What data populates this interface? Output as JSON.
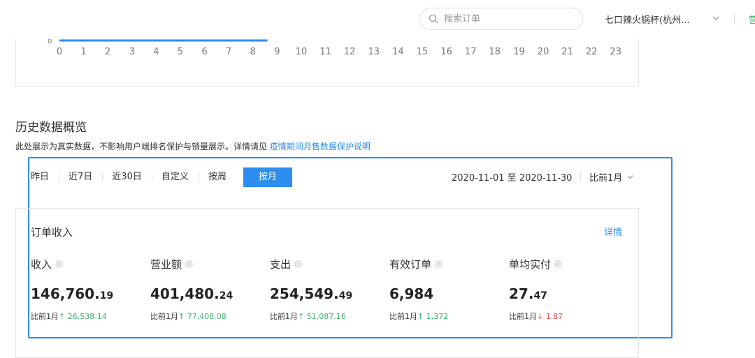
{
  "header": {
    "search_placeholder": "搜索订单",
    "store_name": "七口辣火锅杯(杭州...",
    "right_edge_text": "营"
  },
  "hourly_chart": {
    "x_ticks": [
      "0",
      "1",
      "2",
      "3",
      "4",
      "5",
      "6",
      "7",
      "8",
      "9",
      "10",
      "11",
      "12",
      "13",
      "14",
      "15",
      "16",
      "17",
      "18",
      "19",
      "20",
      "21",
      "22",
      "23"
    ],
    "y_zero_label": "0",
    "line_color": "#2d8ef0"
  },
  "history": {
    "title": "历史数据概览",
    "desc_prefix": "此处展示为真实数据，不影响用户端排名保护与销量展示。详情请见",
    "desc_link": "疫情期间月售数据保护说明",
    "tabs": [
      {
        "label": "昨日",
        "active": false
      },
      {
        "label": "近7日",
        "active": false
      },
      {
        "label": "近30日",
        "active": false
      },
      {
        "label": "自定义",
        "active": false
      },
      {
        "label": "按周",
        "active": false
      },
      {
        "label": "按月",
        "active": true
      }
    ],
    "date_range": "2020-11-01 至 2020-11-30",
    "compare_select": "比前1月",
    "highlight_color": "#2d8ef0"
  },
  "orders_card": {
    "title": "订单收入",
    "detail_link": "详情",
    "metrics": [
      {
        "label": "收入",
        "value_int": "146,760.",
        "value_dec": "19",
        "cmp_prefix": "比前1月",
        "trend": "↑",
        "delta": "26,538.14",
        "direction": "up"
      },
      {
        "label": "营业额",
        "value_int": "401,480.",
        "value_dec": "24",
        "cmp_prefix": "比前1月",
        "trend": "↑",
        "delta": "77,408.08",
        "direction": "up"
      },
      {
        "label": "支出",
        "value_int": "254,549.",
        "value_dec": "49",
        "cmp_prefix": "比前1月",
        "trend": "↑",
        "delta": "51,087.16",
        "direction": "up"
      },
      {
        "label": "有效订单",
        "value_int": "6,984",
        "value_dec": "",
        "cmp_prefix": "比前1月",
        "trend": "↑",
        "delta": "1,372",
        "direction": "up"
      },
      {
        "label": "单均实付",
        "value_int": "27.",
        "value_dec": "47",
        "cmp_prefix": "比前1月",
        "trend": "↓",
        "delta": "1.87",
        "direction": "down"
      }
    ]
  },
  "colors": {
    "accent": "#2d8ef0",
    "up": "#3ab26a",
    "down": "#e64848"
  }
}
